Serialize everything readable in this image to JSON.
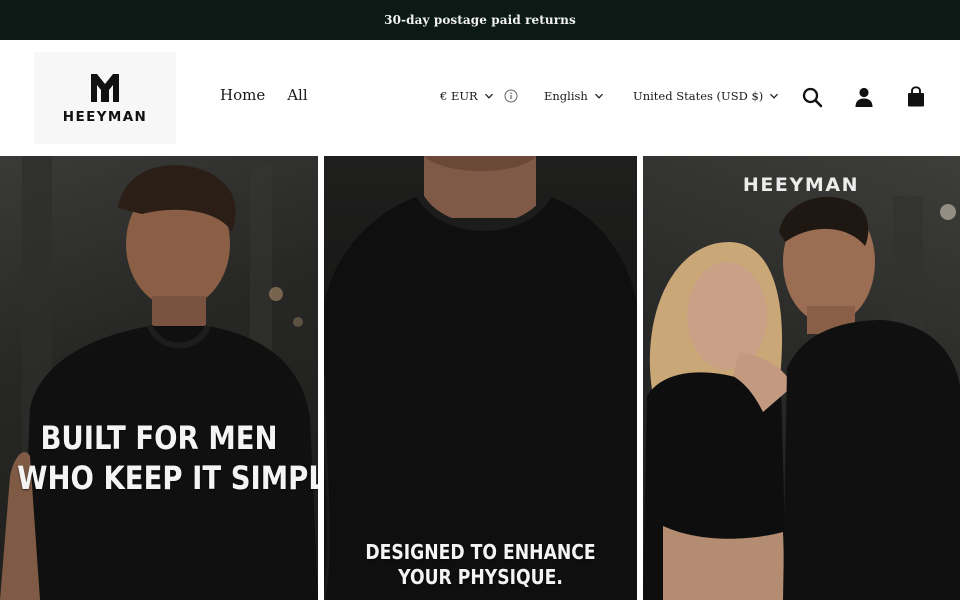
{
  "announcement": {
    "text": "30-day postage paid returns"
  },
  "header": {
    "logo_text": "HEEYMAN",
    "nav": [
      {
        "label": "Home"
      },
      {
        "label": "All"
      }
    ],
    "currency": {
      "label": "€ EUR"
    },
    "language": {
      "label": "English"
    },
    "country": {
      "label": "United States (USD $)"
    },
    "icons": [
      "search-icon",
      "account-icon",
      "cart-icon"
    ]
  },
  "hero": {
    "panel1_caption_line1": "BUILT FOR MEN",
    "panel1_caption_line2": "WHO KEEP IT SIMPLE.",
    "panel2_caption_line1": "DESIGNED TO ENHANCE",
    "panel2_caption_line2": "YOUR PHYSIQUE.",
    "panel3_brand": "HEEYMAN"
  },
  "colors": {
    "announcement_bg": "#0b1a14",
    "announcement_text": "#f2f2f2",
    "header_bg": "#ffffff",
    "text": "#111111"
  }
}
